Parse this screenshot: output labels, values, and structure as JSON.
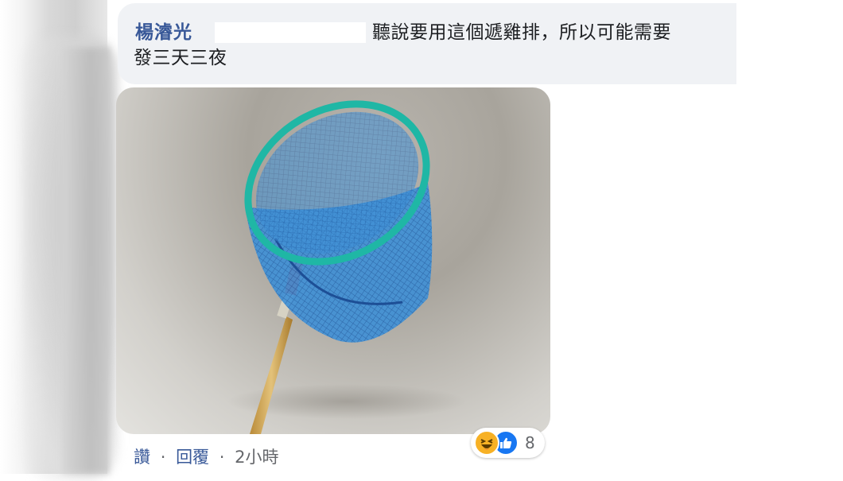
{
  "comment": {
    "author": "楊濬光",
    "text_line1": "聽說要用這個遞雞排，所以可能需要",
    "text_line2": "發三天三夜"
  },
  "attachment": {
    "icon": "fishing-net-photo"
  },
  "actions": {
    "like_label": "讚",
    "reply_label": "回覆",
    "separator": "·",
    "timestamp": "2小時"
  },
  "reactions": {
    "icons": [
      "haha-icon",
      "like-icon"
    ],
    "count": "8",
    "colors": {
      "haha": "#f7b125",
      "like": "#1877f2"
    }
  },
  "colors": {
    "author": "#385898",
    "bubble": "#f0f2f5",
    "meta_text": "#65676b"
  }
}
